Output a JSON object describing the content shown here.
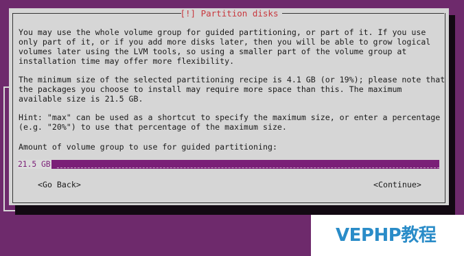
{
  "dialog": {
    "title": "[!] Partition disks",
    "paragraphs": [
      "You may use the whole volume group for guided partitioning, or part of it. If you use\nonly part of it, or if you add more disks later, then you will be able to grow logical\nvolumes later using the LVM tools, so using a smaller part of the volume group at\ninstallation time may offer more flexibility.",
      "The minimum size of the selected partitioning recipe is 4.1 GB (or 19%); please note that\nthe packages you choose to install may require more space than this. The maximum\navailable size is 21.5 GB.",
      "Hint: \"max\" can be used as a shortcut to specify the maximum size, or enter a percentage\n(e.g. \"20%\") to use that percentage of the maximum size.",
      "Amount of volume group to use for guided partitioning:"
    ],
    "input": {
      "value": "21.5 GB"
    },
    "buttons": {
      "back": "<Go Back>",
      "continue": "<Continue>"
    }
  },
  "watermark": {
    "text": "VEPHP教程"
  },
  "colors": {
    "background": "#6e2a6c",
    "dialog": "#d6d6d6",
    "title": "#c8383e",
    "input_bar": "#7a1f77",
    "watermark_text": "#2a8cc8"
  }
}
